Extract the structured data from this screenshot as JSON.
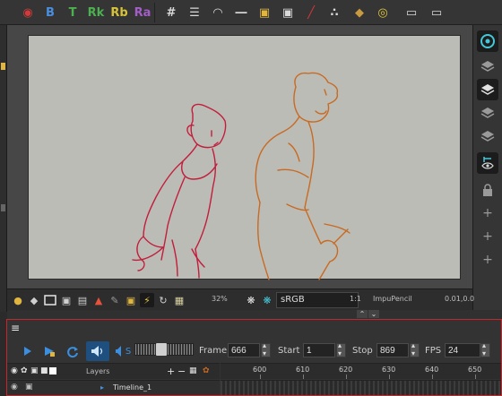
{
  "toolbar": {
    "tools": [
      {
        "icon": "red-circle-brush-icon",
        "glyph": "◉",
        "color": "#d23b3b"
      },
      {
        "icon": "blue-b-icon",
        "glyph": "B",
        "color": "#4b8ee0"
      },
      {
        "icon": "green-t-icon",
        "glyph": "T",
        "color": "#4caf50"
      },
      {
        "icon": "green-rk-icon",
        "glyph": "Rk",
        "color": "#4caf50"
      },
      {
        "icon": "yellow-rb-icon",
        "glyph": "Rb",
        "color": "#d6c33a"
      },
      {
        "icon": "purple-ra-icon",
        "glyph": "Ra",
        "color": "#a45ec7"
      },
      {
        "icon": "grid-icon",
        "glyph": "#",
        "color": "#d9d9d9"
      },
      {
        "icon": "onion-skin-icon",
        "glyph": "☰",
        "color": "#d9d9d9"
      },
      {
        "icon": "light-table-icon",
        "glyph": "◠",
        "color": "#d9d9d9"
      },
      {
        "icon": "line-icon",
        "glyph": "―",
        "color": "#d9d9d9"
      },
      {
        "icon": "lock-icon",
        "glyph": "▣",
        "color": "#e0b640"
      },
      {
        "icon": "lock-gear-icon",
        "glyph": "▣",
        "color": "#d9d9d9"
      },
      {
        "icon": "ruler-icon",
        "glyph": "╱",
        "color": "#d0383a"
      },
      {
        "icon": "dotted-line-icon",
        "glyph": "∴",
        "color": "#d9d9d9"
      },
      {
        "icon": "stack-icon",
        "glyph": "◆",
        "color": "#c79b3e"
      },
      {
        "icon": "stopwatch-icon",
        "glyph": "◎",
        "color": "#e0c63e"
      },
      {
        "icon": "toggle-icon",
        "glyph": "▭",
        "color": "#d9d9d9"
      },
      {
        "icon": "toggle-icon-2",
        "glyph": "▭",
        "color": "#d9d9d9"
      }
    ]
  },
  "statusbar": {
    "zoom": "32%",
    "colorspace": "sRGB",
    "scale": "1:1",
    "tool_name": "ImpuPencil",
    "coords": "0.01,0.0"
  },
  "timeline": {
    "menu_glyph": "≡",
    "sound_label": "S",
    "frame_label": "Frame",
    "frame_value": "666",
    "start_label": "Start",
    "start_value": "1",
    "stop_label": "Stop",
    "stop_value": "869",
    "fps_label": "FPS",
    "fps_value": "24",
    "volume_percent": 45,
    "layers_label": "Layers",
    "layer_name": "Timeline_1",
    "ruler_ticks": [
      "600",
      "610",
      "620",
      "630",
      "640",
      "650"
    ]
  },
  "colors": {
    "accent_red": "#c8262a",
    "character_left": "#c21e3c",
    "character_right": "#c86a22",
    "canvas": "#bcbcb6"
  }
}
